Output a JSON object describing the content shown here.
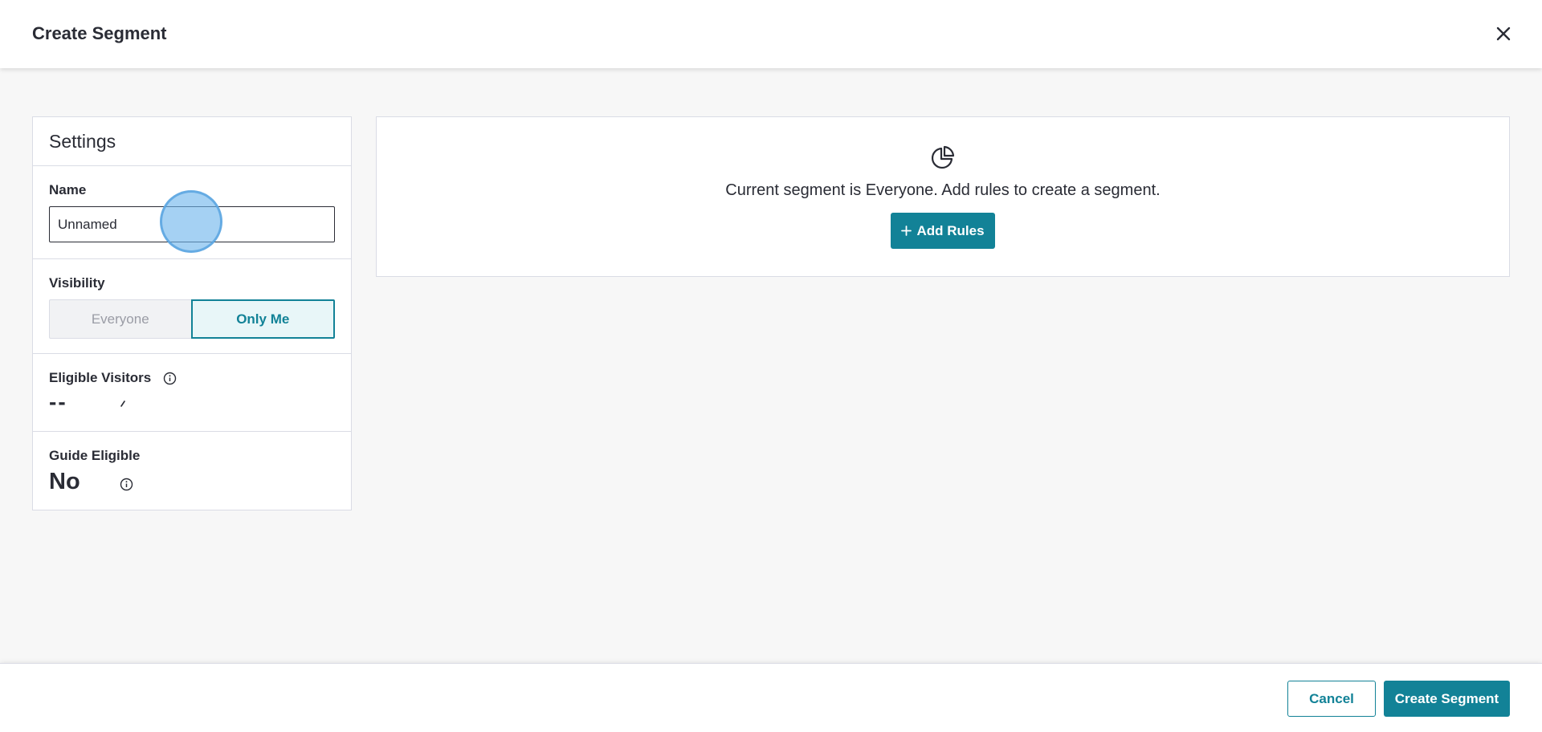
{
  "header": {
    "title": "Create Segment",
    "close_icon": "close-icon"
  },
  "settings": {
    "title": "Settings",
    "name": {
      "label": "Name",
      "value": "Unnamed"
    },
    "visibility": {
      "label": "Visibility",
      "options": [
        "Everyone",
        "Only Me"
      ],
      "selected": "Only Me"
    },
    "eligible_visitors": {
      "label": "Eligible Visitors",
      "value": "--",
      "info_icon": "info-icon"
    },
    "guide_eligible": {
      "label": "Guide Eligible",
      "value": "No",
      "info_icon": "info-icon"
    }
  },
  "rules": {
    "icon": "pie-chart-icon",
    "message": "Current segment is Everyone. Add rules to create a segment.",
    "add_button": {
      "icon": "plus-icon",
      "label": "Add Rules"
    }
  },
  "footer": {
    "cancel_label": "Cancel",
    "create_label": "Create Segment"
  },
  "colors": {
    "accent": "#128297",
    "text": "#2a2c35",
    "border": "#dadce5",
    "background": "#f7f7f7"
  }
}
